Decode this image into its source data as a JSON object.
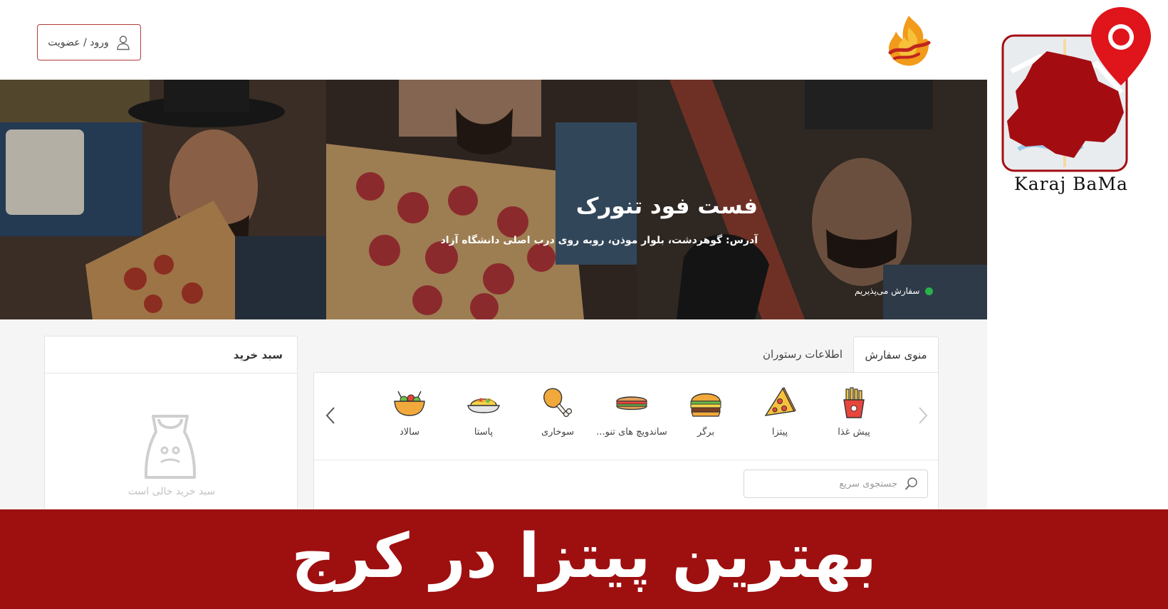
{
  "header": {
    "login_label": "ورود / عضویت",
    "logo_alt": "تنورک"
  },
  "badge": {
    "text": "Karaj BaMa",
    "color": "#a30d12",
    "pin_color": "#e0141b"
  },
  "hero": {
    "title": "فست فود تنورک",
    "address": "آدرس: گوهردشت، بلوار موذن، روبه روی درب اصلی دانشگاه آزاد",
    "status": "سفارش می‌پذیریم",
    "status_color": "#27b24a"
  },
  "tabs": [
    {
      "label": "منوی سفارش",
      "active": true
    },
    {
      "label": "اطلاعات رستوران",
      "active": false
    }
  ],
  "categories": [
    {
      "label": "پیش غذا",
      "icon": "fries-icon"
    },
    {
      "label": "پیتزا",
      "icon": "pizza-icon"
    },
    {
      "label": "برگر",
      "icon": "burger-icon"
    },
    {
      "label": "ساندویچ های تنو...",
      "icon": "sandwich-icon"
    },
    {
      "label": "سوخاری",
      "icon": "chicken-leg-icon"
    },
    {
      "label": "پاستا",
      "icon": "pasta-icon"
    },
    {
      "label": "سالاد",
      "icon": "salad-icon"
    }
  ],
  "search": {
    "placeholder": "جستجوی سریع",
    "value": ""
  },
  "cart": {
    "title": "سبد خرید",
    "empty_text": "سبد خرید خالی است"
  },
  "banner": {
    "text": "بهترین پیتزا در کرج",
    "color": "#9e0f10"
  }
}
